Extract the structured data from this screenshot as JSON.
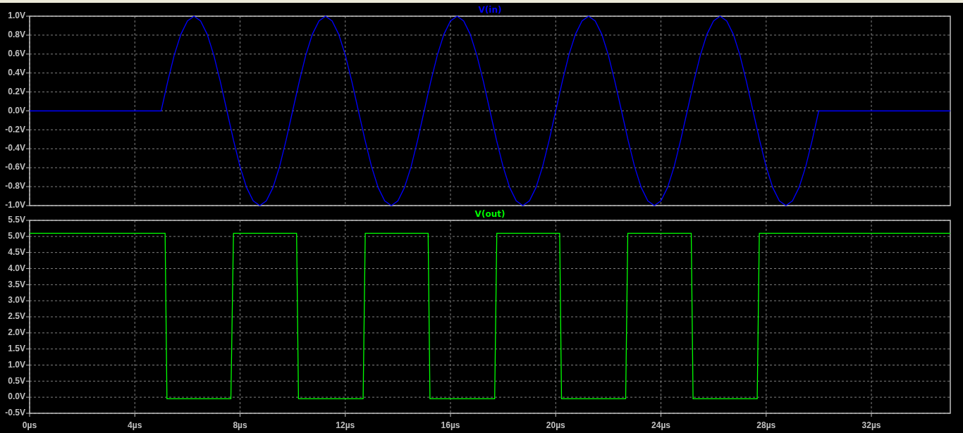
{
  "plots": [
    {
      "chart_data": {
        "type": "line",
        "xlim": [
          0,
          35
        ],
        "ylim": [
          -1,
          1
        ],
        "grid": true,
        "yticks": [
          {
            "value": 1,
            "label": "1.0V"
          },
          {
            "value": 0.8,
            "label": "0.8V"
          },
          {
            "value": 0.6,
            "label": "0.6V"
          },
          {
            "value": 0.4,
            "label": "0.4V"
          },
          {
            "value": 0.2,
            "label": "0.2V"
          },
          {
            "value": 0,
            "label": "0.0V"
          },
          {
            "value": -0.2,
            "label": "-0.2V"
          },
          {
            "value": -0.4,
            "label": "-0.4V"
          },
          {
            "value": -0.6,
            "label": "-0.6V"
          },
          {
            "value": -0.8,
            "label": "-0.8V"
          },
          {
            "value": -1,
            "label": "-1.0V"
          }
        ],
        "x": [
          0,
          5,
          5.25,
          5.5,
          5.75,
          6,
          6.25,
          6.5,
          6.75,
          7,
          7.25,
          7.5,
          7.75,
          8,
          8.25,
          8.5,
          8.75,
          9,
          9.25,
          9.5,
          9.75,
          10,
          10.25,
          10.5,
          10.75,
          11,
          11.25,
          11.5,
          11.75,
          12,
          12.25,
          12.5,
          12.75,
          13,
          13.25,
          13.5,
          13.75,
          14,
          14.25,
          14.5,
          14.75,
          15,
          15.25,
          15.5,
          15.75,
          16,
          16.25,
          16.5,
          16.75,
          17,
          17.25,
          17.5,
          17.75,
          18,
          18.25,
          18.5,
          18.75,
          19,
          19.25,
          19.5,
          19.75,
          20,
          20.25,
          20.5,
          20.75,
          21,
          21.25,
          21.5,
          21.75,
          22,
          22.25,
          22.5,
          22.75,
          23,
          23.25,
          23.5,
          23.75,
          24,
          24.25,
          24.5,
          24.75,
          25,
          25.25,
          25.5,
          25.75,
          26,
          26.25,
          26.5,
          26.75,
          27,
          27.25,
          27.5,
          27.75,
          28,
          28.25,
          28.5,
          28.75,
          29,
          29.25,
          29.5,
          29.75,
          30,
          35
        ],
        "series": [
          {
            "name": "V(in)",
            "color": "#0000ff",
            "values": [
              0,
              0,
              0.31,
              0.59,
              0.81,
              0.95,
              1,
              0.95,
              0.81,
              0.59,
              0.31,
              0,
              -0.31,
              -0.59,
              -0.81,
              -0.95,
              -1,
              -0.95,
              -0.81,
              -0.59,
              -0.31,
              0,
              0.31,
              0.59,
              0.81,
              0.95,
              1,
              0.95,
              0.81,
              0.59,
              0.31,
              0,
              -0.31,
              -0.59,
              -0.81,
              -0.95,
              -1,
              -0.95,
              -0.81,
              -0.59,
              -0.31,
              0,
              0.31,
              0.59,
              0.81,
              0.95,
              1,
              0.95,
              0.81,
              0.59,
              0.31,
              0,
              -0.31,
              -0.59,
              -0.81,
              -0.95,
              -1,
              -0.95,
              -0.81,
              -0.59,
              -0.31,
              0,
              0.31,
              0.59,
              0.81,
              0.95,
              1,
              0.95,
              0.81,
              0.59,
              0.31,
              0,
              -0.31,
              -0.59,
              -0.81,
              -0.95,
              -1,
              -0.95,
              -0.81,
              -0.59,
              -0.31,
              0,
              0.31,
              0.59,
              0.81,
              0.95,
              1,
              0.95,
              0.81,
              0.59,
              0.31,
              0,
              -0.31,
              -0.59,
              -0.81,
              -0.95,
              -1,
              -0.95,
              -0.81,
              -0.59,
              -0.31,
              0,
              0
            ]
          }
        ]
      }
    },
    {
      "chart_data": {
        "type": "line",
        "xlim": [
          0,
          35
        ],
        "ylim": [
          -0.5,
          5.5
        ],
        "grid": true,
        "xticks": [
          {
            "value": 0,
            "label": "0µs"
          },
          {
            "value": 4,
            "label": "4µs"
          },
          {
            "value": 8,
            "label": "8µs"
          },
          {
            "value": 12,
            "label": "12µs"
          },
          {
            "value": 16,
            "label": "16µs"
          },
          {
            "value": 20,
            "label": "20µs"
          },
          {
            "value": 24,
            "label": "24µs"
          },
          {
            "value": 28,
            "label": "28µs"
          },
          {
            "value": 32,
            "label": "32µs"
          }
        ],
        "yticks": [
          {
            "value": 5.5,
            "label": "5.5V"
          },
          {
            "value": 5,
            "label": "5.0V"
          },
          {
            "value": 4.5,
            "label": "4.5V"
          },
          {
            "value": 4,
            "label": "4.0V"
          },
          {
            "value": 3.5,
            "label": "3.5V"
          },
          {
            "value": 3,
            "label": "3.0V"
          },
          {
            "value": 2.5,
            "label": "2.5V"
          },
          {
            "value": 2,
            "label": "2.0V"
          },
          {
            "value": 1.5,
            "label": "1.5V"
          },
          {
            "value": 1,
            "label": "1.0V"
          },
          {
            "value": 0.5,
            "label": "0.5V"
          },
          {
            "value": 0,
            "label": "0.0V"
          },
          {
            "value": -0.5,
            "label": "-0.5V"
          }
        ],
        "x": [
          0,
          5.15,
          5.22,
          7.65,
          7.75,
          10.15,
          10.22,
          12.68,
          12.76,
          15.15,
          15.22,
          17.68,
          17.76,
          20.15,
          20.22,
          22.66,
          22.74,
          25.15,
          25.22,
          27.66,
          27.74,
          35
        ],
        "series": [
          {
            "name": "V(out)",
            "color": "#00ff00",
            "values": [
              5.1,
              5.1,
              -0.05,
              -0.05,
              5.1,
              5.1,
              -0.05,
              -0.05,
              5.1,
              5.1,
              -0.05,
              -0.05,
              5.1,
              5.1,
              -0.05,
              -0.05,
              5.1,
              5.1,
              -0.05,
              -0.05,
              5.1,
              5.1
            ]
          }
        ]
      }
    }
  ]
}
